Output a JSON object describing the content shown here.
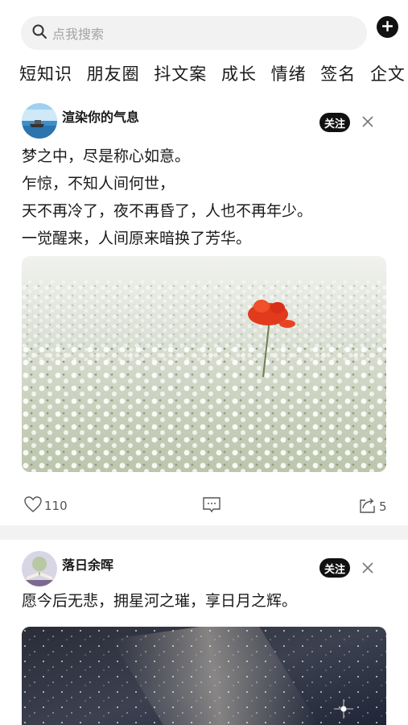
{
  "search": {
    "placeholder": "点我搜索",
    "icon": "search-icon"
  },
  "add_button": {
    "icon": "plus-icon"
  },
  "tabs": [
    "短知识",
    "朋友圈",
    "抖文案",
    "成长",
    "情绪",
    "签名",
    "企文"
  ],
  "posts": [
    {
      "author": "渲染你的气息",
      "follow_label": "关注",
      "lines": [
        "梦之中，尽是称心如意。",
        "乍惊，不知人间何世，",
        "天不再冷了，夜不再昏了，人也不再年少。",
        "一觉醒来，人间原来暗换了芳华。"
      ],
      "likes": "110",
      "shares": "5"
    },
    {
      "author": "落日余晖",
      "follow_label": "关注",
      "lines": [
        "愿今后无悲，拥星河之璀，享日月之辉。"
      ]
    }
  ],
  "colors": {
    "accent": "#111111",
    "background": "#ffffff",
    "muted": "#a3a3a3",
    "divider": "#f2f2f2"
  }
}
